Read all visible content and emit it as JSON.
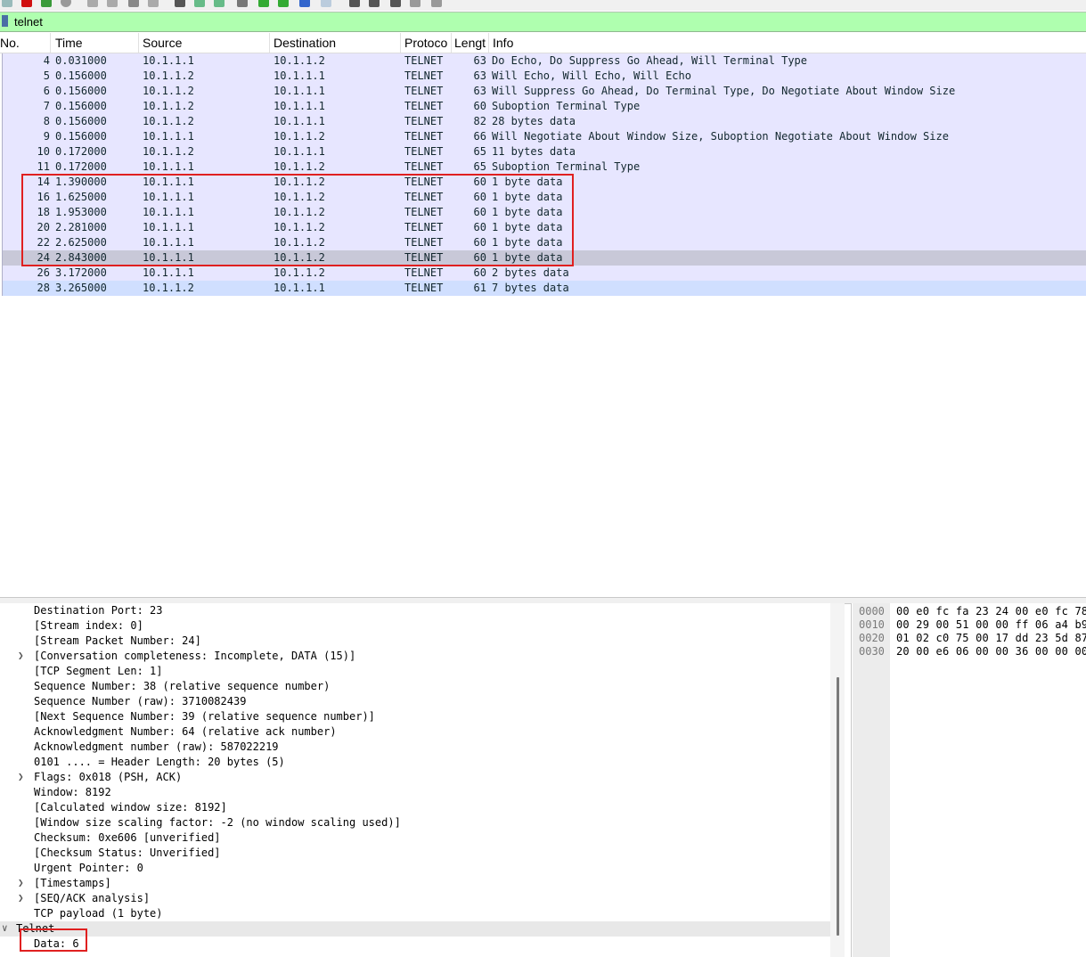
{
  "filter": {
    "value": "telnet"
  },
  "columns": [
    "No.",
    "Time",
    "Source",
    "Destination",
    "Protoco",
    "Lengt",
    "Info"
  ],
  "packets": [
    {
      "no": "4",
      "time": "0.031000",
      "src": "10.1.1.1",
      "dst": "10.1.1.2",
      "proto": "TELNET",
      "len": "63",
      "info": "Do Echo, Do Suppress Go Ahead, Will Terminal Type"
    },
    {
      "no": "5",
      "time": "0.156000",
      "src": "10.1.1.2",
      "dst": "10.1.1.1",
      "proto": "TELNET",
      "len": "63",
      "info": "Will Echo, Will Echo, Will Echo"
    },
    {
      "no": "6",
      "time": "0.156000",
      "src": "10.1.1.2",
      "dst": "10.1.1.1",
      "proto": "TELNET",
      "len": "63",
      "info": "Will Suppress Go Ahead, Do Terminal Type, Do Negotiate About Window Size"
    },
    {
      "no": "7",
      "time": "0.156000",
      "src": "10.1.1.2",
      "dst": "10.1.1.1",
      "proto": "TELNET",
      "len": "60",
      "info": "Suboption Terminal Type"
    },
    {
      "no": "8",
      "time": "0.156000",
      "src": "10.1.1.2",
      "dst": "10.1.1.1",
      "proto": "TELNET",
      "len": "82",
      "info": "28 bytes data"
    },
    {
      "no": "9",
      "time": "0.156000",
      "src": "10.1.1.1",
      "dst": "10.1.1.2",
      "proto": "TELNET",
      "len": "66",
      "info": "Will Negotiate About Window Size, Suboption Negotiate About Window Size"
    },
    {
      "no": "10",
      "time": "0.172000",
      "src": "10.1.1.2",
      "dst": "10.1.1.1",
      "proto": "TELNET",
      "len": "65",
      "info": "11 bytes data"
    },
    {
      "no": "11",
      "time": "0.172000",
      "src": "10.1.1.1",
      "dst": "10.1.1.2",
      "proto": "TELNET",
      "len": "65",
      "info": "Suboption Terminal Type"
    },
    {
      "no": "14",
      "time": "1.390000",
      "src": "10.1.1.1",
      "dst": "10.1.1.2",
      "proto": "TELNET",
      "len": "60",
      "info": "1 byte data"
    },
    {
      "no": "16",
      "time": "1.625000",
      "src": "10.1.1.1",
      "dst": "10.1.1.2",
      "proto": "TELNET",
      "len": "60",
      "info": "1 byte data"
    },
    {
      "no": "18",
      "time": "1.953000",
      "src": "10.1.1.1",
      "dst": "10.1.1.2",
      "proto": "TELNET",
      "len": "60",
      "info": "1 byte data"
    },
    {
      "no": "20",
      "time": "2.281000",
      "src": "10.1.1.1",
      "dst": "10.1.1.2",
      "proto": "TELNET",
      "len": "60",
      "info": "1 byte data"
    },
    {
      "no": "22",
      "time": "2.625000",
      "src": "10.1.1.1",
      "dst": "10.1.1.2",
      "proto": "TELNET",
      "len": "60",
      "info": "1 byte data"
    },
    {
      "no": "24",
      "time": "2.843000",
      "src": "10.1.1.1",
      "dst": "10.1.1.2",
      "proto": "TELNET",
      "len": "60",
      "info": "1 byte data"
    },
    {
      "no": "26",
      "time": "3.172000",
      "src": "10.1.1.1",
      "dst": "10.1.1.2",
      "proto": "TELNET",
      "len": "60",
      "info": "2 bytes data"
    },
    {
      "no": "28",
      "time": "3.265000",
      "src": "10.1.1.2",
      "dst": "10.1.1.1",
      "proto": "TELNET",
      "len": "61",
      "info": "7 bytes data"
    }
  ],
  "selected_packet": "24",
  "details": [
    {
      "text": "Destination Port: 23",
      "expander": ""
    },
    {
      "text": "[Stream index: 0]",
      "expander": ""
    },
    {
      "text": "[Stream Packet Number: 24]",
      "expander": ""
    },
    {
      "text": "[Conversation completeness: Incomplete, DATA (15)]",
      "expander": "collapsed"
    },
    {
      "text": "[TCP Segment Len: 1]",
      "expander": ""
    },
    {
      "text": "Sequence Number: 38    (relative sequence number)",
      "expander": ""
    },
    {
      "text": "Sequence Number (raw): 3710082439",
      "expander": ""
    },
    {
      "text": "[Next Sequence Number: 39    (relative sequence number)]",
      "expander": ""
    },
    {
      "text": "Acknowledgment Number: 64    (relative ack number)",
      "expander": ""
    },
    {
      "text": "Acknowledgment number (raw): 587022219",
      "expander": ""
    },
    {
      "text": "0101 .... = Header Length: 20 bytes (5)",
      "expander": ""
    },
    {
      "text": "Flags: 0x018 (PSH, ACK)",
      "expander": "collapsed"
    },
    {
      "text": "Window: 8192",
      "expander": ""
    },
    {
      "text": "[Calculated window size: 8192]",
      "expander": ""
    },
    {
      "text": "[Window size scaling factor: -2 (no window scaling used)]",
      "expander": ""
    },
    {
      "text": "Checksum: 0xe606 [unverified]",
      "expander": ""
    },
    {
      "text": "[Checksum Status: Unverified]",
      "expander": ""
    },
    {
      "text": "Urgent Pointer: 0",
      "expander": ""
    },
    {
      "text": "[Timestamps]",
      "expander": "collapsed"
    },
    {
      "text": "[SEQ/ACK analysis]",
      "expander": "collapsed"
    },
    {
      "text": "TCP payload (1 byte)",
      "expander": ""
    }
  ],
  "telnet_section": {
    "label": "Telnet",
    "expander": "expanded",
    "child": "Data: 6"
  },
  "bytes": [
    {
      "offset": "0000",
      "hex": "00 e0 fc fa 23 24 00 e0  fc 78"
    },
    {
      "offset": "0010",
      "hex": "00 29 00 51 00 00 ff 06  a4 b9"
    },
    {
      "offset": "0020",
      "hex": "01 02 c0 75 00 17 dd 23  5d 87"
    },
    {
      "offset": "0030",
      "hex": "20 00 e6 06 00 00 36 00  00 00"
    }
  ],
  "colors": {
    "row_telnet": "#e7e6ff",
    "row_selected": "#c8c8d8",
    "filter_valid": "#afffaf",
    "annotation_box": "#e02020"
  }
}
